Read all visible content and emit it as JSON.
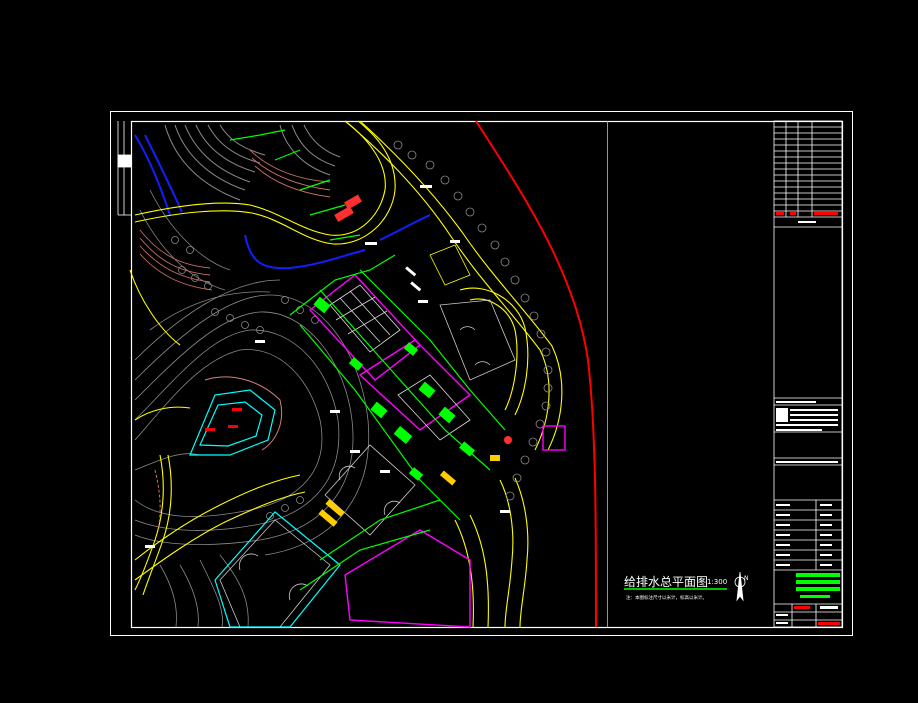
{
  "drawing": {
    "title": "给排水总平面图",
    "scale": "1:300",
    "note": "注：本图标注尺寸以米计，标高以米计。"
  },
  "colors": {
    "background": "#000000",
    "frame": "#ffffff",
    "boundary": "#ff0000",
    "road": "#ffff00",
    "pipe": "#00ff00",
    "building": "#ff00ff",
    "water": "#0000ff",
    "terrain": "#808080",
    "cyan": "#00ffff"
  },
  "icons": {
    "north_arrow": "north-arrow-icon"
  }
}
